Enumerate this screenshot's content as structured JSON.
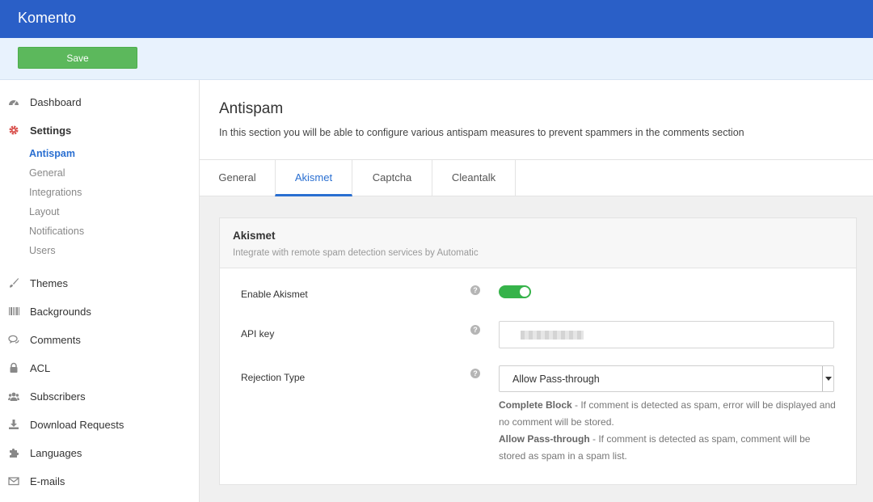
{
  "app": {
    "brand": "Komento"
  },
  "toolbar": {
    "save_label": "Save"
  },
  "sidebar": {
    "items": [
      {
        "label": "Dashboard",
        "icon": "dashboard-icon"
      },
      {
        "label": "Settings",
        "icon": "gear-icon",
        "active": true
      },
      {
        "label": "Themes",
        "icon": "brush-icon"
      },
      {
        "label": "Backgrounds",
        "icon": "barcode-icon"
      },
      {
        "label": "Comments",
        "icon": "comments-icon"
      },
      {
        "label": "ACL",
        "icon": "lock-icon"
      },
      {
        "label": "Subscribers",
        "icon": "users-icon"
      },
      {
        "label": "Download Requests",
        "icon": "download-icon"
      },
      {
        "label": "Languages",
        "icon": "puzzle-icon"
      },
      {
        "label": "E-mails",
        "icon": "envelope-icon"
      }
    ],
    "settings_sub": [
      "Antispam",
      "General",
      "Integrations",
      "Layout",
      "Notifications",
      "Users"
    ]
  },
  "page": {
    "title": "Antispam",
    "description": "In this section you will be able to configure various antispam measures to prevent spammers in the comments section"
  },
  "tabs": [
    "General",
    "Akismet",
    "Captcha",
    "Cleantalk"
  ],
  "active_tab": "Akismet",
  "panel": {
    "title": "Akismet",
    "subtitle": "Integrate with remote spam detection services by Automatic",
    "fields": {
      "enable": {
        "label": "Enable Akismet",
        "value": true
      },
      "api_key": {
        "label": "API key"
      },
      "rejection": {
        "label": "Rejection Type",
        "selected": "Allow Pass-through"
      }
    },
    "help_glyph": "?",
    "notes": {
      "complete_title": "Complete Block",
      "complete_text": " - If comment is detected as spam, error will be displayed and no comment will be stored.",
      "pass_title": "Allow Pass-through",
      "pass_text": " - If comment is detected as spam, comment will be stored as spam in a spam list."
    }
  },
  "colors": {
    "topbar": "#2a5fc7",
    "accent": "#2a6fd1",
    "save": "#5cb85c",
    "settings_icon": "#d9534f",
    "toggle_on": "#36b34a"
  }
}
